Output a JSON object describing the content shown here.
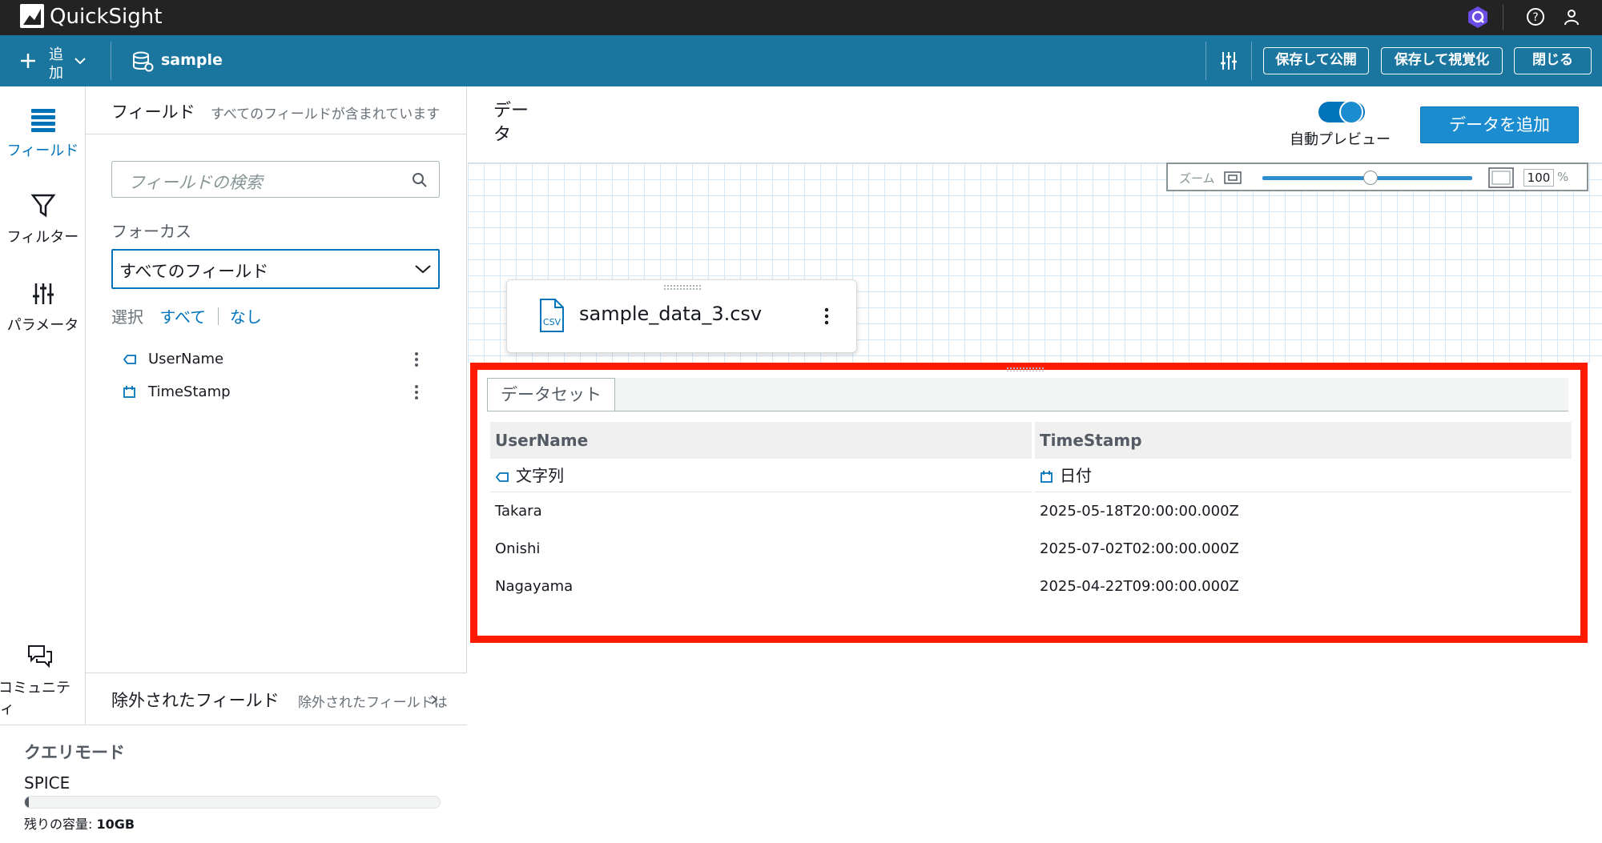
{
  "app": {
    "title": "QuickSight"
  },
  "toolbar": {
    "add_label_1": "追",
    "add_label_2": "加",
    "dataset_name": "sample",
    "publish_label": "保存して公開",
    "visualize_label": "保存して視覚化",
    "close_label": "閉じる"
  },
  "rail": {
    "fields": "フィールド",
    "filter": "フィルター",
    "params": "パラメータ",
    "community": "コミュニテ",
    "community_2": "ィ"
  },
  "fields_panel": {
    "title": "フィールド",
    "subtitle": "すべてのフィールドが含まれています",
    "search_placeholder": "フィールドの検索",
    "focus_label": "フォーカス",
    "focus_value": "すべてのフィールド",
    "select_label": "選択",
    "select_all": "すべて",
    "select_none": "なし",
    "fields": [
      {
        "name": "UserName",
        "type": "string"
      },
      {
        "name": "TimeStamp",
        "type": "date"
      }
    ]
  },
  "excluded": {
    "title": "除外されたフィールド",
    "subtitle": "除外されたフィールドは"
  },
  "query": {
    "title": "クエリモード",
    "mode": "SPICE",
    "capacity_label": "残りの容量:",
    "capacity_value": "10GB",
    "capacity_used_fraction": 0.01
  },
  "main": {
    "title": "データ",
    "auto_preview": "自動プレビュー",
    "add_data": "データを追加",
    "zoom_label": "ズーム",
    "zoom_value": "100",
    "zoom_unit": "%",
    "file_name": "sample_data_3.csv",
    "file_badge": "CSV"
  },
  "dataset": {
    "tab": "データセット",
    "columns": [
      {
        "name": "UserName",
        "type": "文字列"
      },
      {
        "name": "TimeStamp",
        "type": "日付"
      }
    ],
    "rows": [
      [
        "Takara",
        "2025-05-18T20:00:00.000Z"
      ],
      [
        "Onishi",
        "2025-07-02T02:00:00.000Z"
      ],
      [
        "Nagayama",
        "2025-04-22T09:00:00.000Z"
      ]
    ]
  },
  "colors": {
    "topbar": "#232323",
    "toolbar": "#1a759f",
    "accent": "#0073bb",
    "highlight": "#ff1a00"
  }
}
